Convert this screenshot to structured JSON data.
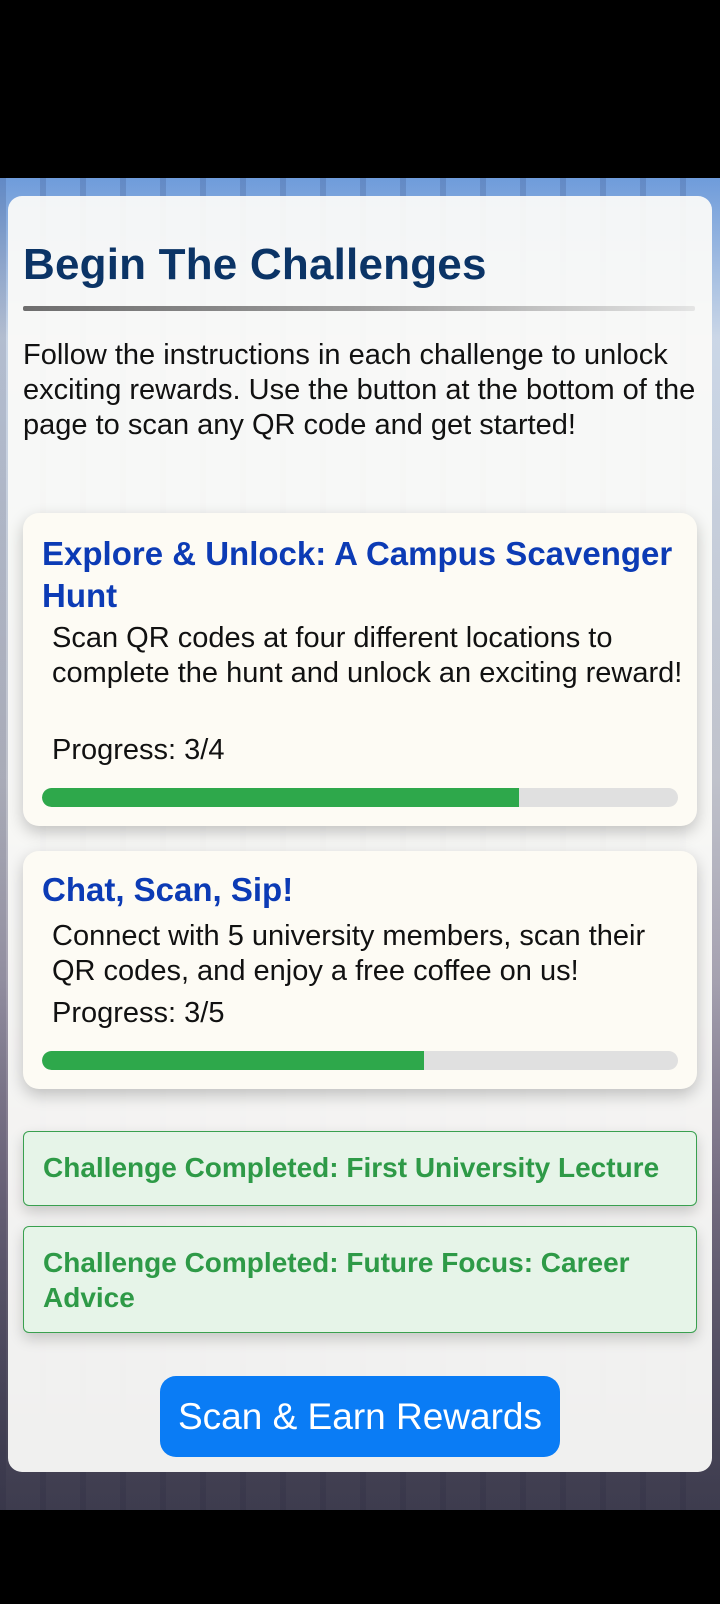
{
  "page": {
    "title": "Begin The Challenges",
    "intro": "Follow the instructions in each challenge to unlock exciting rewards. Use the button at the bottom of the page to scan any QR code and get started!"
  },
  "challenges": [
    {
      "title": "Explore & Unlock: A Campus Scavenger Hunt",
      "description": "Scan QR codes at four different locations to complete the hunt and unlock an exciting reward!",
      "progress_label": "Progress: 3/4",
      "progress_fraction": 0.75
    },
    {
      "title": "Chat, Scan, Sip!",
      "description": "Connect with 5 university members, scan their QR codes, and enjoy a free coffee on us!",
      "progress_label": "Progress: 3/5",
      "progress_fraction": 0.6
    }
  ],
  "completed": [
    "Challenge Completed: First University Lecture",
    "Challenge Completed: Future Focus: Career Advice"
  ],
  "scan_button": "Scan & Earn Rewards",
  "colors": {
    "title": "#0b3466",
    "card_title": "#0c3bb5",
    "progress": "#2ea84b",
    "completed_text": "#2e9a47",
    "button": "#0a7cf5"
  }
}
